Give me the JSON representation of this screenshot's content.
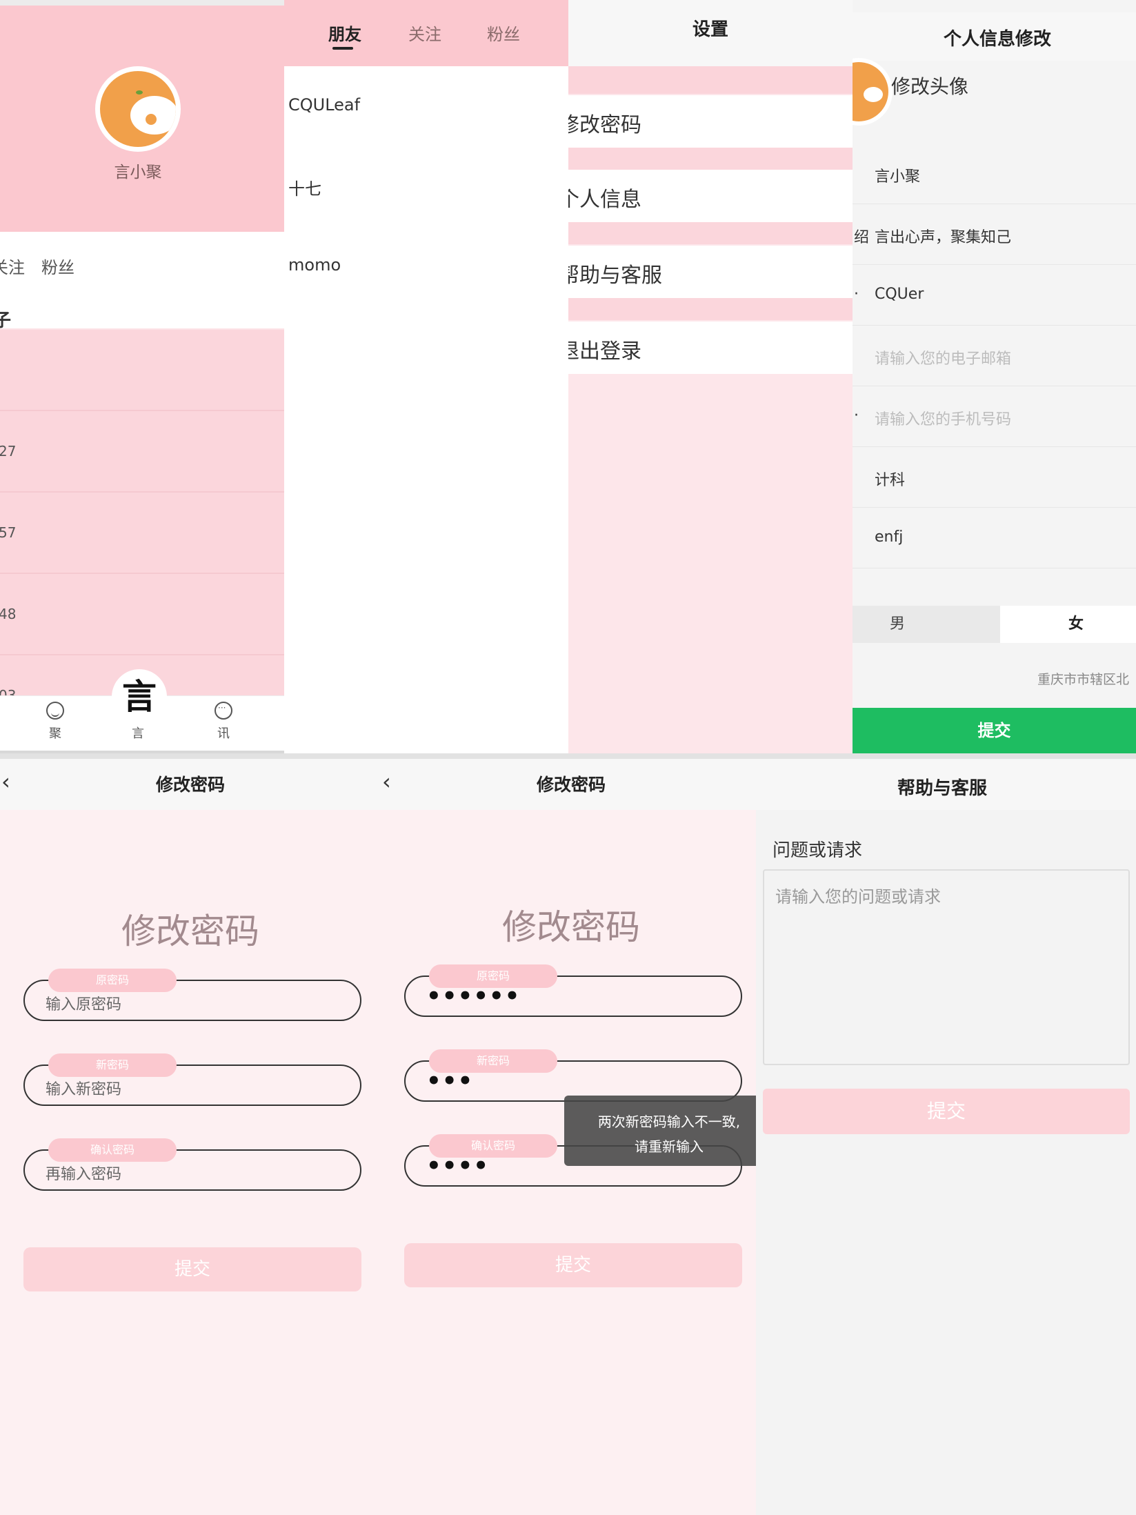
{
  "profile": {
    "username": "言小聚",
    "stats": [
      "关注",
      "粉丝"
    ],
    "section_title": "子",
    "rows": [
      "",
      "27",
      "57",
      "48",
      "03"
    ],
    "tabs": [
      {
        "label": "聚",
        "icon": "smile-icon"
      },
      {
        "label": "言",
        "icon": "yan-character-icon"
      },
      {
        "label": "讯",
        "icon": "chat-icon"
      }
    ],
    "center_char": "言"
  },
  "friends": {
    "tabs": [
      "朋友",
      "关注",
      "粉丝"
    ],
    "active_tab": "朋友",
    "list": [
      "CQULeaf",
      "十七",
      "momo"
    ]
  },
  "settings": {
    "title": "设置",
    "items": [
      "修改密码",
      "个人信息",
      "帮助与客服",
      "退出登录"
    ]
  },
  "edit_profile": {
    "title": "个人信息修改",
    "avatar_label": "修改头像",
    "fields": [
      {
        "key": "",
        "value": "言小聚",
        "placeholder": ""
      },
      {
        "key": "绍",
        "value": "言出心声，聚集知己",
        "placeholder": ""
      },
      {
        "key": "·",
        "value": "CQUer",
        "placeholder": ""
      },
      {
        "key": "",
        "value": "",
        "placeholder": "请输入您的电子邮箱"
      },
      {
        "key": "·",
        "value": "",
        "placeholder": "请输入您的手机号码"
      },
      {
        "key": "",
        "value": "计科",
        "placeholder": ""
      },
      {
        "key": "",
        "value": "enfj",
        "placeholder": ""
      }
    ],
    "gender_options": [
      "男",
      "女"
    ],
    "gender_selected": "女",
    "address": "重庆市市辖区北",
    "submit_label": "提交",
    "submit_color": "#1ebd61"
  },
  "change_password": {
    "title": "修改密码",
    "heading": "修改密码",
    "tags": [
      "原密码",
      "新密码",
      "确认密码"
    ],
    "placeholders": [
      "输入原密码",
      "输入新密码",
      "再输入密码"
    ],
    "filled_values": [
      "••••••",
      "•••",
      "••••"
    ],
    "submit_label": "提交",
    "toast_line1": "两次新密码输入不一致,",
    "toast_line2": "请重新输入"
  },
  "help": {
    "title": "帮助与客服",
    "label": "问题或请求",
    "placeholder": "请输入您的问题或请求",
    "submit_label": "提交"
  },
  "colors": {
    "pink_header": "#fbc8cf",
    "pink_light": "#fde2e6",
    "green_submit": "#1ebd61"
  }
}
